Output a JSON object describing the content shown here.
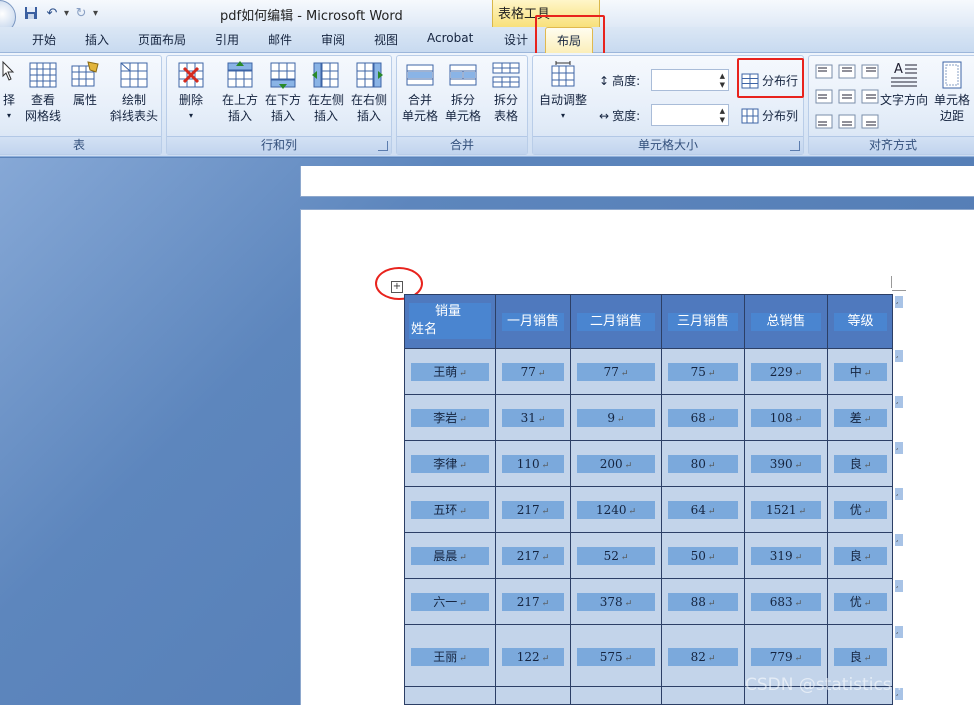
{
  "window": {
    "title": "pdf如何编辑 - Microsoft Word",
    "context_group": "表格工具"
  },
  "tabs": [
    "开始",
    "插入",
    "页面布局",
    "引用",
    "邮件",
    "审阅",
    "视图",
    "Acrobat",
    "设计"
  ],
  "active_tab": "布局",
  "ribbon": {
    "group_table": {
      "label": "表",
      "select": "择",
      "view_grid_line1": "查看",
      "view_grid_line2": "网格线",
      "properties": "属性",
      "draw_line1": "绘制",
      "draw_line2": "斜线表头"
    },
    "group_rows_cols": {
      "label": "行和列",
      "delete": "删除",
      "insert_above_1": "在上方",
      "insert_above_2": "插入",
      "insert_below_1": "在下方",
      "insert_below_2": "插入",
      "insert_left_1": "在左侧",
      "insert_left_2": "插入",
      "insert_right_1": "在右侧",
      "insert_right_2": "插入"
    },
    "group_merge": {
      "label": "合并",
      "merge_cells_1": "合并",
      "merge_cells_2": "单元格",
      "split_cells_1": "拆分",
      "split_cells_2": "单元格",
      "split_table_1": "拆分",
      "split_table_2": "表格"
    },
    "group_cell_size": {
      "label": "单元格大小",
      "autofit": "自动调整",
      "height_label": "高度:",
      "width_label": "宽度:",
      "distribute_rows": "分布行",
      "distribute_cols": "分布列"
    },
    "group_align": {
      "label": "对齐方式",
      "text_direction": "文字方向",
      "cell_margins_1": "单元格",
      "cell_margins_2": "边距"
    }
  },
  "table": {
    "header": {
      "diagonal_top": "销量",
      "diagonal_bottom": "姓名",
      "columns": [
        "一月销售",
        "二月销售",
        "三月销售",
        "总销售",
        "等级"
      ]
    },
    "rows": [
      {
        "name": "王萌",
        "jan": "77",
        "feb": "77",
        "mar": "75",
        "total": "229",
        "grade": "中"
      },
      {
        "name": "李岩",
        "jan": "31",
        "feb": "9",
        "mar": "68",
        "total": "108",
        "grade": "差"
      },
      {
        "name": "李律",
        "jan": "110",
        "feb": "200",
        "mar": "80",
        "total": "390",
        "grade": "良"
      },
      {
        "name": "五环",
        "jan": "217",
        "feb": "1240",
        "mar": "64",
        "total": "1521",
        "grade": "优"
      },
      {
        "name": "晨晨",
        "jan": "217",
        "feb": "52",
        "mar": "50",
        "total": "319",
        "grade": "良"
      },
      {
        "name": "六一",
        "jan": "217",
        "feb": "378",
        "mar": "88",
        "total": "683",
        "grade": "优"
      },
      {
        "name": "王丽",
        "jan": "122",
        "feb": "575",
        "mar": "82",
        "total": "779",
        "grade": "良"
      }
    ]
  },
  "watermark": "CSDN @statistics.insight"
}
